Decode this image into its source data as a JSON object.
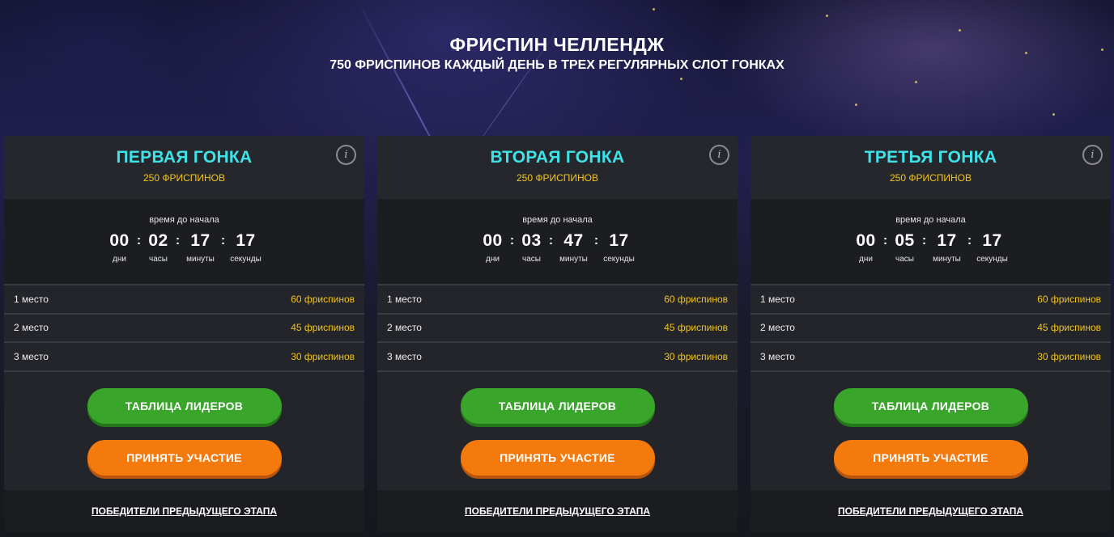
{
  "header": {
    "title": "ФРИСПИН ЧЕЛЛЕНДЖ",
    "subtitle": "750 ФРИСПИНОВ КАЖДЫЙ ДЕНЬ В ТРЕХ РЕГУЛЯРНЫХ СЛОТ ГОНКАХ"
  },
  "colors": {
    "title_accent": "#3ee3e8",
    "prize_accent": "#f2c41e",
    "leaderboard_button": "#3aa52b",
    "join_button": "#f57a0d"
  },
  "races": [
    {
      "title": "ПЕРВАЯ ГОНКА",
      "subtitle": "250 ФРИСПИНОВ",
      "info_icon": "info-icon",
      "timer_caption": "время до начала",
      "timer": {
        "days": "00",
        "hours": "02",
        "minutes": "17",
        "seconds": "17",
        "days_label": "дни",
        "hours_label": "часы",
        "minutes_label": "минуты",
        "seconds_label": "секунды"
      },
      "prizes": [
        {
          "place": "1 место",
          "value": "60 фриспинов"
        },
        {
          "place": "2 место",
          "value": "45 фриспинов"
        },
        {
          "place": "3 место",
          "value": "30 фриспинов"
        }
      ],
      "leaderboard_label": "ТАБЛИЦА ЛИДЕРОВ",
      "join_label": "ПРИНЯТЬ УЧАСТИЕ",
      "winners_link": "ПОБЕДИТЕЛИ ПРЕДЫДУЩЕГО ЭТАПА"
    },
    {
      "title": "ВТОРАЯ ГОНКА",
      "subtitle": "250 ФРИСПИНОВ",
      "info_icon": "info-icon",
      "timer_caption": "время до начала",
      "timer": {
        "days": "00",
        "hours": "03",
        "minutes": "47",
        "seconds": "17",
        "days_label": "дни",
        "hours_label": "часы",
        "minutes_label": "минуты",
        "seconds_label": "секунды"
      },
      "prizes": [
        {
          "place": "1 место",
          "value": "60 фриспинов"
        },
        {
          "place": "2 место",
          "value": "45 фриспинов"
        },
        {
          "place": "3 место",
          "value": "30 фриспинов"
        }
      ],
      "leaderboard_label": "ТАБЛИЦА ЛИДЕРОВ",
      "join_label": "ПРИНЯТЬ УЧАСТИЕ",
      "winners_link": "ПОБЕДИТЕЛИ ПРЕДЫДУЩЕГО ЭТАПА"
    },
    {
      "title": "ТРЕТЬЯ ГОНКА",
      "subtitle": "250 ФРИСПИНОВ",
      "info_icon": "info-icon",
      "timer_caption": "время до начала",
      "timer": {
        "days": "00",
        "hours": "05",
        "minutes": "17",
        "seconds": "17",
        "days_label": "дни",
        "hours_label": "часы",
        "minutes_label": "минуты",
        "seconds_label": "секунды"
      },
      "prizes": [
        {
          "place": "1 место",
          "value": "60 фриспинов"
        },
        {
          "place": "2 место",
          "value": "45 фриспинов"
        },
        {
          "place": "3 место",
          "value": "30 фриспинов"
        }
      ],
      "leaderboard_label": "ТАБЛИЦА ЛИДЕРОВ",
      "join_label": "ПРИНЯТЬ УЧАСТИЕ",
      "winners_link": "ПОБЕДИТЕЛИ ПРЕДЫДУЩЕГО ЭТАПА"
    }
  ]
}
